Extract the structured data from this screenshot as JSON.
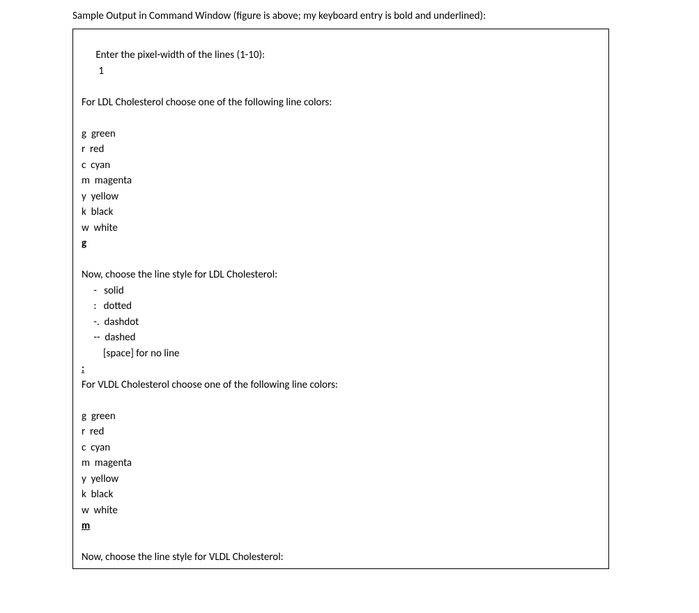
{
  "caption": "Sample Output in Command Window (figure is above; my keyboard entry is bold and underlined):",
  "prompts": {
    "width_prompt": "Enter the pixel-width of the lines (1-10):",
    "width_value": "1",
    "ldl_color_prompt": "For LDL Cholesterol choose one of the following line colors:",
    "ldl_style_prompt": "Now, choose the line style for LDL Cholesterol:",
    "vldl_color_prompt": "For VLDL Cholesterol choose one of the following line colors:",
    "vldl_style_prompt": "Now, choose the line style for VLDL Cholesterol:"
  },
  "color_options": {
    "g": "g  green",
    "r": "r  red",
    "c": "c  cyan",
    "m": "m  magenta",
    "y": "y  yellow",
    "k": "k  black",
    "w": "w  white"
  },
  "style_options": {
    "solid": " -   solid",
    "dotted": " :   dotted",
    "dashdot": " -.  dashdot",
    "dashed": " --  dashed",
    "noline": "     [space] for no line"
  },
  "inputs": {
    "ldl_color": "g",
    "ldl_style": ":",
    "vldl_color": "m"
  }
}
